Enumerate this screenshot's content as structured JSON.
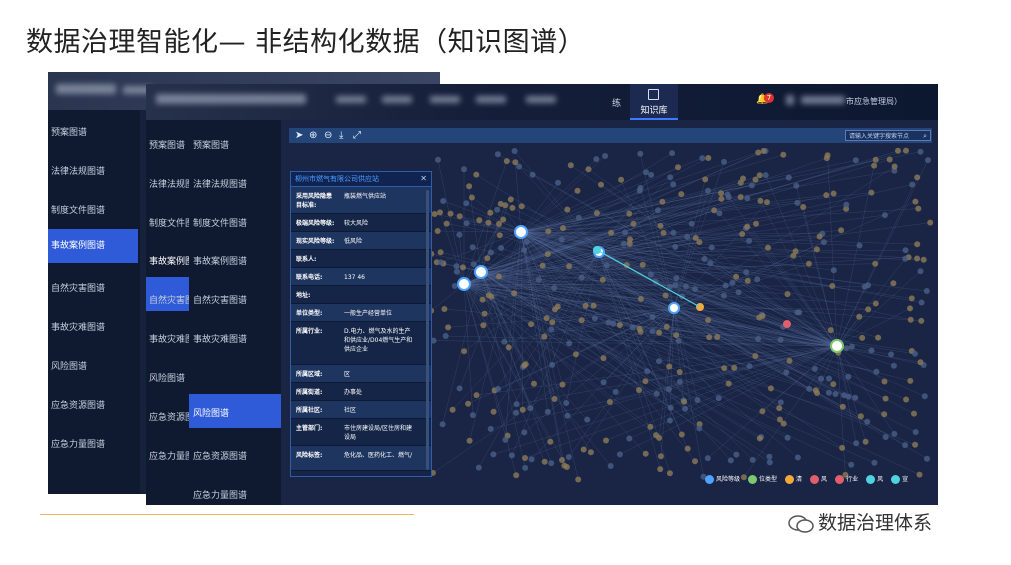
{
  "slide": {
    "title": "数据治理智能化— 非结构化数据（知识图谱）",
    "watermark": "数据治理体系"
  },
  "back_screen": {
    "menu": [
      "预案图谱",
      "法律法规图谱",
      "制度文件图谱",
      "事故案例图谱",
      "自然灾害图谱",
      "事故灾难图谱",
      "风险图谱",
      "应急资源图谱",
      "应急力量图谱"
    ],
    "active_index": 3
  },
  "front_screen": {
    "header": {
      "nav_partial": "练",
      "knowledge_tab": "知识库",
      "badge_count": "7",
      "user_label": "市应急管理局）"
    },
    "sidebar_narrow": [
      "预案图谱",
      "法律法规图",
      "制度文件图",
      "事故案例图",
      "自然灾害图",
      "事故灾难图",
      "风险图谱",
      "应急资源图",
      "应急力量图"
    ],
    "sidebar_narrow_active": 3,
    "sidebar_wide": [
      "预案图谱",
      "法律法规图谱",
      "制度文件图谱",
      "事故案例图谱",
      "自然灾害图谱",
      "事故灾难图谱",
      "风险图谱",
      "应急资源图谱",
      "应急力量图谱"
    ],
    "sidebar_wide_active": 6,
    "search_placeholder": "请输入关键字搜索节点",
    "popup": {
      "title": "柳州市燃气有限公司供应站",
      "fields": [
        {
          "k": "采用风险隐患目标准:",
          "v": "瓶装燃气供应站"
        },
        {
          "k": "极端风险等级:",
          "v": "较大风险"
        },
        {
          "k": "现实风险等级:",
          "v": "低风险"
        },
        {
          "k": "联系人:",
          "v": ""
        },
        {
          "k": "联系电话:",
          "v": "137 46"
        },
        {
          "k": "地址:",
          "v": ""
        },
        {
          "k": "单位类型:",
          "v": "一般生产经营单位"
        },
        {
          "k": "所属行业:",
          "v": "D.电力、燃气及水的生产和供应业/D04燃气生产和供应企业"
        },
        {
          "k": "所属区域:",
          "v": "区"
        },
        {
          "k": "所属街道:",
          "v": "办事处"
        },
        {
          "k": "所属社区:",
          "v": "社区"
        },
        {
          "k": "主管部门:",
          "v": "市住房建设局/区住房和建设局"
        },
        {
          "k": "风险标签:",
          "v": "危化品、医药化工、燃气/"
        }
      ]
    },
    "legend": [
      {
        "label": "风险等级",
        "color": "#4da3ff"
      },
      {
        "label": "位类型",
        "color": "#7cc96f"
      },
      {
        "label": "清",
        "color": "#f0a93a"
      },
      {
        "label": "风",
        "color": "#e05f6a"
      },
      {
        "label": "行业",
        "color": "#e05f6a"
      },
      {
        "label": "风",
        "color": "#4fd3e0"
      },
      {
        "label": "宣",
        "color": "#4fd3e0"
      }
    ]
  }
}
